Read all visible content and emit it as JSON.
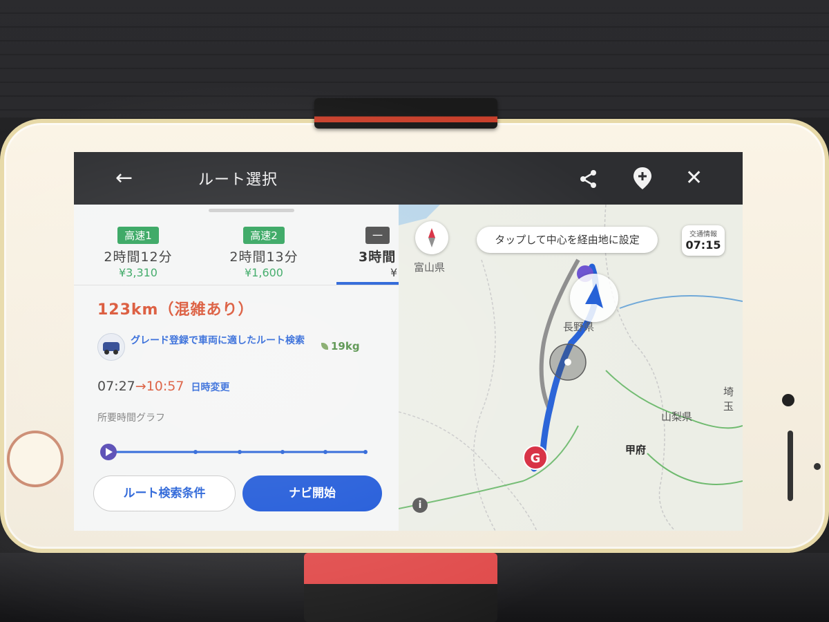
{
  "header": {
    "title": "ルート選択",
    "back_icon": "←",
    "close_icon": "✕"
  },
  "tabs": [
    {
      "badge": "高速1",
      "time": "2時間12分",
      "price": "¥3,310",
      "selected": false
    },
    {
      "badge": "高速2",
      "time": "2時間13分",
      "price": "¥1,600",
      "selected": false
    },
    {
      "badge": "一",
      "time": "3時間",
      "price": "¥",
      "selected": true
    }
  ],
  "route": {
    "distance": "123km（混雑あり）",
    "grade_link": "グレード登録で車両に適したルート検索",
    "co2": "19kg",
    "depart": "07:27",
    "arrow": "→",
    "arrive": "10:57",
    "date_change": "日時変更",
    "graph_label": "所要時間グラフ"
  },
  "buttons": {
    "conditions": "ルート検索条件",
    "start_nav": "ナビ開始"
  },
  "map": {
    "tap_hint": "タップして中心を経由地に設定",
    "traffic_label": "交通情報",
    "traffic_time": "07:15",
    "labels": {
      "toyama": "富山県",
      "nagano": "長野県",
      "yamanashi": "山梨県",
      "kofu": "甲府",
      "saitama": "埼玉"
    },
    "goal_marker": "G",
    "info": "i"
  },
  "colors": {
    "accent_blue": "#1a55d8",
    "highway_green": "#2fa35b",
    "distance_red": "#d84b2a",
    "goal_red": "#d6283c"
  }
}
